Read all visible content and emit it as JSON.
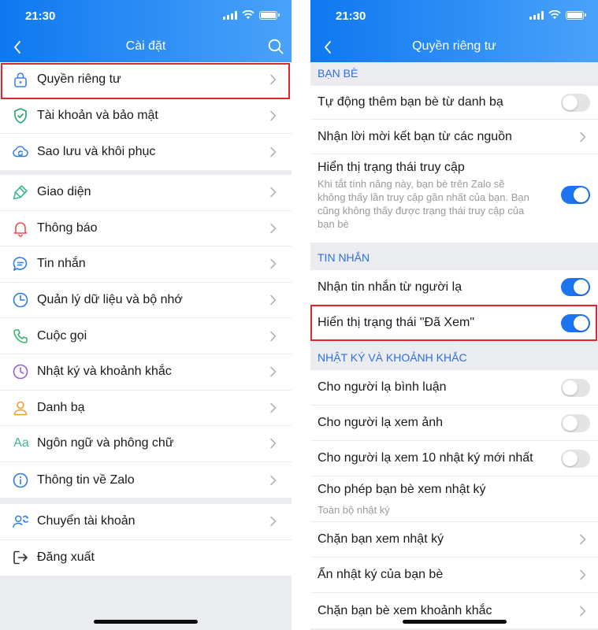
{
  "left": {
    "status_time": "21:30",
    "title": "Cài đặt",
    "items": [
      {
        "label": "Quyền riêng tư",
        "icon": "lock-icon",
        "color": "#3b82f6"
      },
      {
        "label": "Tài khoản và bảo mật",
        "icon": "shield-icon",
        "color": "#22a36b"
      },
      {
        "label": "Sao lưu và khôi phục",
        "icon": "cloud-sync-icon",
        "color": "#2c7be5"
      },
      {
        "label": "Giao diện",
        "icon": "paintbrush-icon",
        "color": "#3dbb8c"
      },
      {
        "label": "Thông báo",
        "icon": "bell-icon",
        "color": "#ef5350"
      },
      {
        "label": "Tin nhắn",
        "icon": "message-icon",
        "color": "#2c7be5"
      },
      {
        "label": "Quản lý dữ liệu và bộ nhớ",
        "icon": "clock-pie-icon",
        "color": "#2c7be5"
      },
      {
        "label": "Cuộc gọi",
        "icon": "phone-icon",
        "color": "#3bb56c"
      },
      {
        "label": "Nhật ký và khoảnh khắc",
        "icon": "journal-clock-icon",
        "color": "#8e63d2"
      },
      {
        "label": "Danh bạ",
        "icon": "contact-icon",
        "color": "#f39c33"
      },
      {
        "label": "Ngôn ngữ và phông chữ",
        "icon": "font-icon",
        "color": "#3dbb8c",
        "glyph": "Aa"
      },
      {
        "label": "Thông tin về Zalo",
        "icon": "info-icon",
        "color": "#2c7be5"
      },
      {
        "label": "Chuyển tài khoản",
        "icon": "switch-account-icon",
        "color": "#2c7be5"
      },
      {
        "label": "Đăng xuất",
        "icon": "logout-icon",
        "color": "#333333"
      }
    ]
  },
  "right": {
    "status_time": "21:30",
    "title": "Quyền riêng tư",
    "sections": [
      {
        "heading": "BẠN BÈ"
      },
      {
        "heading": "TIN NHẮN"
      },
      {
        "heading": "NHẬT KÝ VÀ KHOẢNH KHẮC"
      }
    ],
    "rows": [
      {
        "label": "Tự động thêm bạn bè từ danh bạ",
        "control": "toggle",
        "on": false
      },
      {
        "label": "Nhận lời mời kết bạn từ các nguồn",
        "control": "chevron"
      },
      {
        "label": "Hiển thị trạng thái truy cập",
        "control": "toggle",
        "on": true,
        "description": [
          "Khi tắt tính năng này, bạn bè trên Zalo sẽ",
          "không thấy lần truy cập gần nhất của bạn. Bạn",
          "cũng không thấy được trạng thái truy cập của",
          "bạn bè"
        ]
      },
      {
        "label": "Nhận tin nhắn từ người lạ",
        "control": "toggle",
        "on": true
      },
      {
        "label": "Hiển thị trạng thái \"Đã Xem\"",
        "control": "toggle",
        "on": true
      },
      {
        "label": "Cho người lạ bình luận",
        "control": "toggle",
        "on": false
      },
      {
        "label": "Cho người lạ xem ảnh",
        "control": "toggle",
        "on": false
      },
      {
        "label": "Cho người lạ xem 10 nhật ký mới nhất",
        "control": "toggle",
        "on": false
      },
      {
        "label": "Cho phép bạn bè xem nhật ký",
        "control": "none",
        "sublabel": "Toàn bộ nhật ký"
      },
      {
        "label": "Chặn bạn xem nhật ký",
        "control": "chevron"
      },
      {
        "label": "Ẩn nhật ký của bạn bè",
        "control": "chevron"
      },
      {
        "label": "Chặn bạn bè xem khoảnh khắc",
        "control": "chevron"
      }
    ]
  },
  "colors": {
    "header": "#1a7cf2",
    "accent": "#1e74f0",
    "highlight": "#e3262b",
    "section": "#2d6fd9"
  }
}
